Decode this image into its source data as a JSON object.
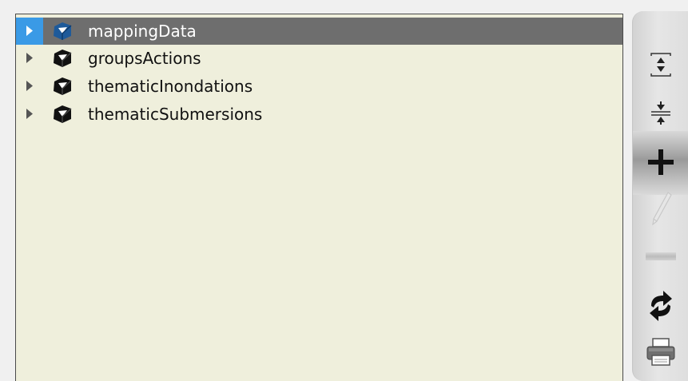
{
  "tree": {
    "items": [
      {
        "label": "mappingData",
        "selected": true,
        "icon": "cube-icon"
      },
      {
        "label": "groupsActions",
        "selected": false,
        "icon": "cube-icon"
      },
      {
        "label": "thematicInondations",
        "selected": false,
        "icon": "cube-icon"
      },
      {
        "label": "thematicSubmersions",
        "selected": false,
        "icon": "cube-icon"
      }
    ]
  },
  "toolbar": {
    "buttons": [
      {
        "name": "expand-all",
        "icon": "expand-all-icon",
        "enabled": true
      },
      {
        "name": "collapse-all",
        "icon": "collapse-all-icon",
        "enabled": true
      },
      {
        "name": "add",
        "icon": "plus-icon",
        "enabled": true
      },
      {
        "name": "edit",
        "icon": "pencil-icon",
        "enabled": false
      },
      {
        "name": "delete",
        "icon": "minus-icon",
        "enabled": false
      },
      {
        "name": "refresh",
        "icon": "refresh-icon",
        "enabled": true
      },
      {
        "name": "print",
        "icon": "printer-icon",
        "enabled": true
      }
    ]
  },
  "colors": {
    "panel_background": "#efefdc",
    "selected_row": "#6e6e6e",
    "selected_expander": "#3a9ae6",
    "selected_icon": "#1e5a9a"
  }
}
